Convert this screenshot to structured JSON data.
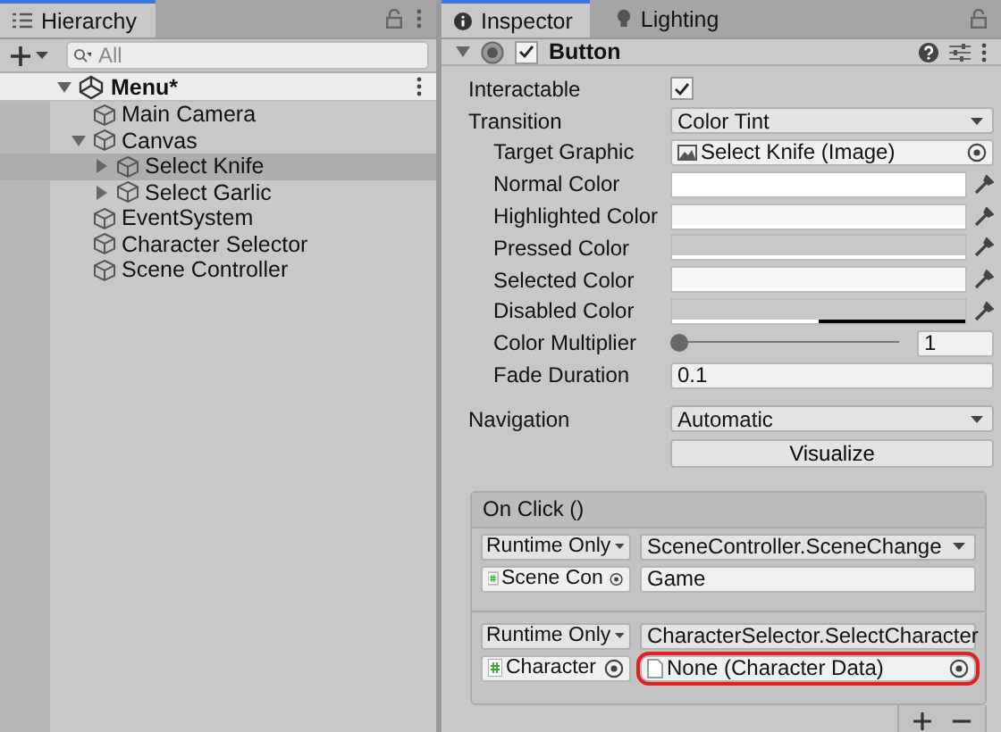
{
  "hierarchy": {
    "title": "Hierarchy",
    "search": {
      "placeholder": "All"
    },
    "scene": {
      "name": "Menu*",
      "expanded": true,
      "children": [
        {
          "name": "Main Camera",
          "selected": false
        },
        {
          "name": "Canvas",
          "selected": false,
          "expanded": true,
          "children": [
            {
              "name": "Select Knife",
              "selected": true,
              "expanded": false
            },
            {
              "name": "Select Garlic",
              "selected": false,
              "expanded": false
            }
          ]
        },
        {
          "name": "EventSystem",
          "selected": false
        },
        {
          "name": "Character Selector",
          "selected": false
        },
        {
          "name": "Scene Controller",
          "selected": false
        }
      ]
    }
  },
  "inspector": {
    "tabs": [
      {
        "label": "Inspector",
        "selected": true
      },
      {
        "label": "Lighting",
        "selected": false
      }
    ],
    "component": {
      "name": "Button",
      "enabled": true,
      "expanded": true
    },
    "properties": [
      {
        "label": "Interactable",
        "kind": "checkbox",
        "checked": true
      },
      {
        "label": "Transition",
        "kind": "dropdown",
        "value": "Color Tint",
        "children": [
          {
            "label": "Target Graphic",
            "kind": "object",
            "value": "Select Knife (Image)"
          },
          {
            "label": "Normal Color",
            "kind": "color",
            "color": "#ffffff",
            "level": 1
          },
          {
            "label": "Highlighted Color",
            "kind": "color",
            "color": "#f5f5f5",
            "level": 1
          },
          {
            "label": "Pressed Color",
            "kind": "color",
            "color": "#c8c8c8",
            "level": 1
          },
          {
            "label": "Selected Color",
            "kind": "color",
            "color": "#f5f5f5",
            "level": 1
          },
          {
            "label": "Disabled Color",
            "kind": "color",
            "color": "#c8c8c8",
            "level": 0.5
          },
          {
            "label": "Color Multiplier",
            "kind": "slider",
            "level": 0,
            "value": "1"
          },
          {
            "label": "Fade Duration",
            "kind": "number",
            "value": "0.1"
          }
        ]
      },
      {
        "label": "Navigation",
        "kind": "dropdown",
        "value": "Automatic"
      }
    ],
    "visualize_button": "Visualize",
    "on_click": {
      "title": "On Click ()",
      "entries": [
        {
          "mode": "Runtime Only",
          "function": "SceneController.SceneChange",
          "target": "Scene Con",
          "argument": {
            "kind": "text",
            "value": "Game",
            "highlighted": false
          }
        },
        {
          "mode": "Runtime Only",
          "function": "CharacterSelector.SelectCharacter",
          "target": "Character",
          "argument": {
            "kind": "object",
            "value": "None (Character Data)",
            "highlighted": true
          }
        }
      ]
    }
  }
}
